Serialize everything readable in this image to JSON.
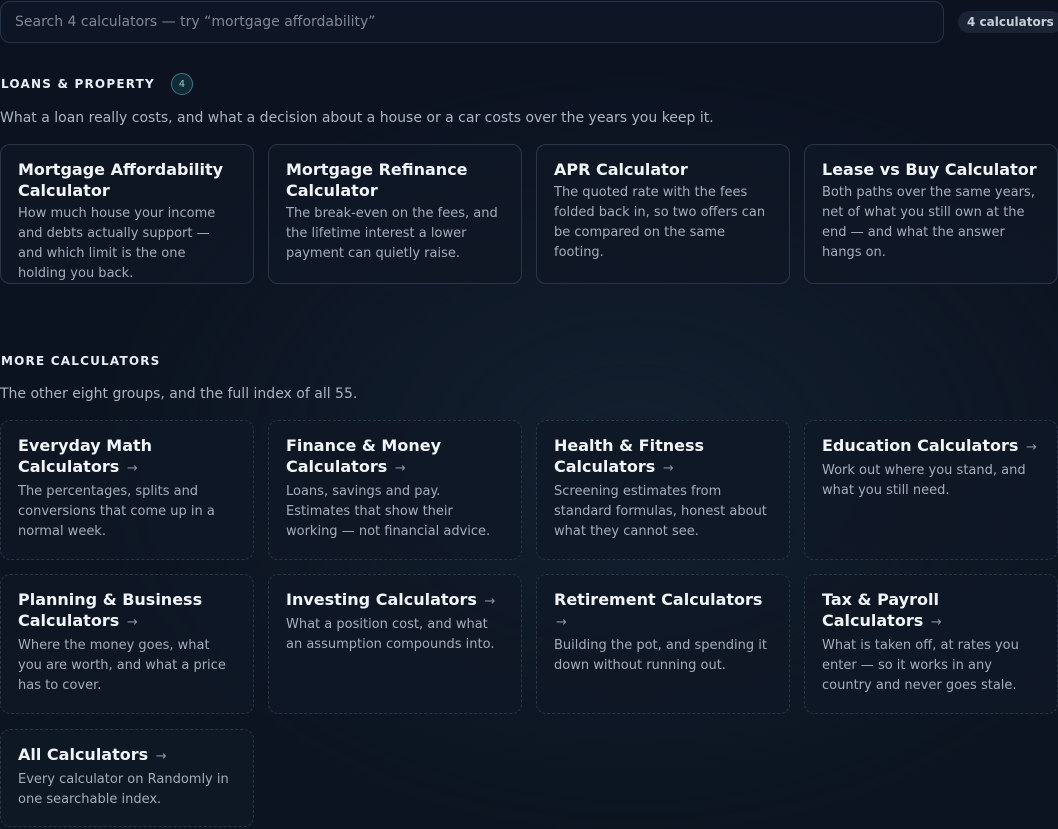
{
  "search": {
    "placeholder": "Search 4 calculators — try “mortgage affordability”",
    "value": "",
    "count_label": "4 calculators"
  },
  "loans": {
    "title": "LOANS & PROPERTY",
    "badge": "4",
    "description": "What a loan really costs, and what a decision about a house or a car costs over the years you keep it.",
    "cards": [
      {
        "title": "Mortgage Affordability Calculator",
        "description": "How much house your income and debts actually support — and which limit is the one holding you back."
      },
      {
        "title": "Mortgage Refinance Calculator",
        "description": "The break-even on the fees, and the lifetime interest a lower payment can quietly raise."
      },
      {
        "title": "APR Calculator",
        "description": "The quoted rate with the fees folded back in, so two offers can be compared on the same footing."
      },
      {
        "title": "Lease vs Buy Calculator",
        "description": "Both paths over the same years, net of what you still own at the end — and what the answer hangs on."
      }
    ]
  },
  "more": {
    "title": "MORE CALCULATORS",
    "description": "The other eight groups, and the full index of all 55.",
    "arrow": "→",
    "cards": [
      {
        "title": "Everyday Math Calculators",
        "description": "The percentages, splits and conversions that come up in a normal week."
      },
      {
        "title": "Finance & Money Calculators",
        "description": "Loans, savings and pay. Estimates that show their working — not financial advice."
      },
      {
        "title": "Health & Fitness Calculators",
        "description": "Screening estimates from standard formulas, honest about what they cannot see."
      },
      {
        "title": "Education Calculators",
        "description": "Work out where you stand, and what you still need."
      },
      {
        "title": "Planning & Business Calculators",
        "description": "Where the money goes, what you are worth, and what a price has to cover."
      },
      {
        "title": "Investing Calculators",
        "description": "What a position cost, and what an assumption compounds into."
      },
      {
        "title": "Retirement Calculators",
        "description": "Building the pot, and spending it down without running out."
      },
      {
        "title": "Tax & Payroll Calculators",
        "description": "What is taken off, at rates you enter — so it works in any country and never goes stale."
      },
      {
        "title": "All Calculators",
        "description": "Every calculator on Randomly in one searchable index."
      }
    ]
  }
}
